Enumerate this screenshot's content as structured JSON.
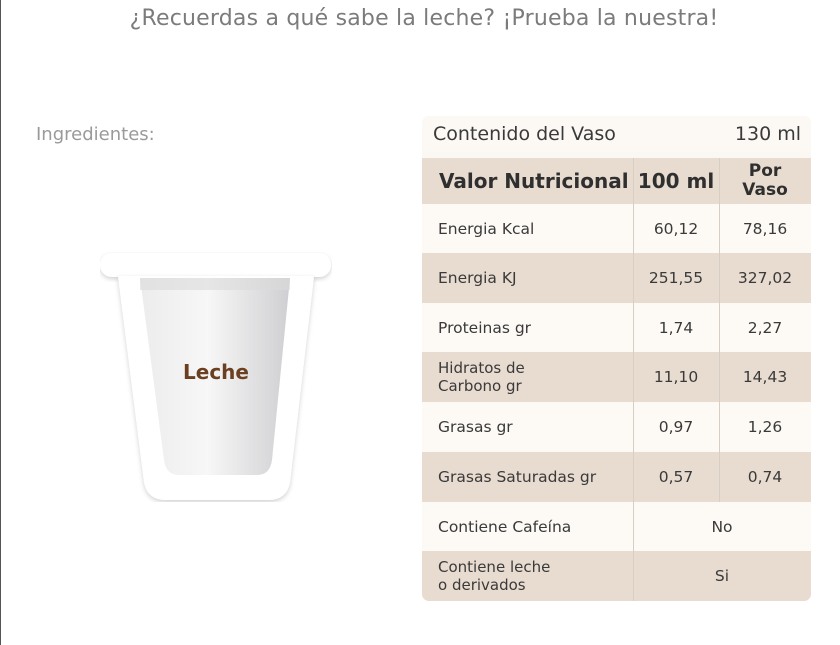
{
  "headline": "¿Recuerdas a qué sabe la leche? ¡Prueba la nuestra!",
  "ingredients_label": "Ingredientes:",
  "cup": {
    "label": "Leche"
  },
  "table": {
    "container_label": "Contenido del Vaso",
    "container_value": "130 ml",
    "headers": [
      "Valor Nutricional",
      "100 ml",
      "Por Vaso"
    ],
    "rows": [
      {
        "name": "Energia Kcal",
        "per100": "60,12",
        "perGlass": "78,16"
      },
      {
        "name": "Energia KJ",
        "per100": "251,55",
        "perGlass": "327,02"
      },
      {
        "name": "Proteinas gr",
        "per100": "1,74",
        "perGlass": "2,27"
      },
      {
        "name": "Hidratos de Carbono gr",
        "per100": "11,10",
        "perGlass": "14,43"
      },
      {
        "name": "Grasas gr",
        "per100": "0,97",
        "perGlass": "1,26"
      },
      {
        "name": "Grasas Saturadas gr",
        "per100": "0,57",
        "perGlass": "0,74"
      }
    ],
    "caffeine": {
      "name": "Contiene Cafeína",
      "value": "No"
    },
    "dairy": {
      "name": "Contiene leche o derivados",
      "value": "Si"
    }
  },
  "colors": {
    "headline": "#7b7b7b",
    "row_dark": "#e8dbd0",
    "row_light": "#fdfaf6",
    "cup_label": "#6b3f1f"
  }
}
